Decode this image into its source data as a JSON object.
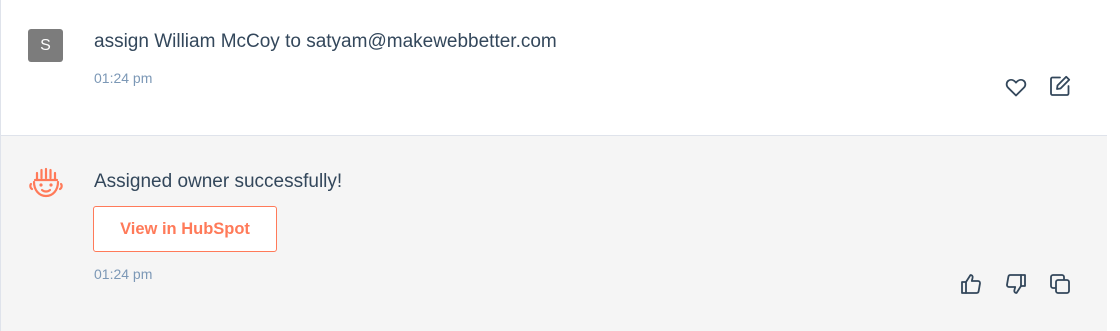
{
  "user_message": {
    "avatar_letter": "S",
    "text": "assign William McCoy to satyam@makewebbetter.com",
    "time": "01:24 pm",
    "actions": [
      {
        "icon": "heart-icon"
      },
      {
        "icon": "edit-icon"
      }
    ]
  },
  "bot_message": {
    "logo_icon": "hubspot-sprocket-face-icon",
    "text": "Assigned owner successfully!",
    "button_label": "View in HubSpot",
    "time": "01:24 pm",
    "actions": [
      {
        "icon": "thumbs-up-icon"
      },
      {
        "icon": "thumbs-down-icon"
      },
      {
        "icon": "copy-icon"
      }
    ]
  },
  "colors": {
    "accent": "#ff7a59",
    "text": "#33475b",
    "muted": "#7c98b6",
    "avatar_bg": "#7c7c7c",
    "bot_bg": "#f5f5f5"
  }
}
